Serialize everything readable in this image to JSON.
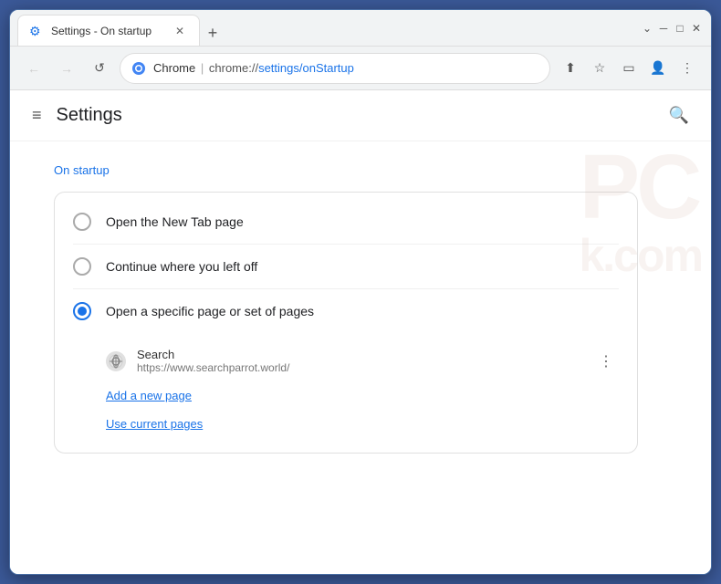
{
  "window": {
    "title": "Settings - On startup",
    "close_label": "✕",
    "minimize_label": "─",
    "maximize_label": "□",
    "dropdown_label": "⌄"
  },
  "tab": {
    "favicon": "⚙",
    "title": "Settings - On startup",
    "close": "✕"
  },
  "new_tab_button": "+",
  "address_bar": {
    "back": "←",
    "forward": "→",
    "refresh": "↺",
    "brand": "Chrome",
    "separator": "|",
    "url_display": "chrome://settings/onStartup",
    "url_prefix": "chrome://",
    "url_path": "settings/onStartup",
    "share_icon": "⬆",
    "bookmark_icon": "☆",
    "sidebar_icon": "▭",
    "profile_icon": "👤",
    "menu_icon": "⋮"
  },
  "page": {
    "menu_icon": "≡",
    "title": "Settings",
    "search_icon": "🔍"
  },
  "on_startup": {
    "section_label": "On startup",
    "options": [
      {
        "id": "new-tab",
        "label": "Open the New Tab page",
        "selected": false
      },
      {
        "id": "continue",
        "label": "Continue where you left off",
        "selected": false
      },
      {
        "id": "specific",
        "label": "Open a specific page or set of pages",
        "selected": true
      }
    ],
    "startup_site": {
      "name": "Search",
      "url": "https://www.searchparrot.world/",
      "more_icon": "⋮"
    },
    "add_new_page": "Add a new page",
    "use_current_pages": "Use current pages"
  },
  "watermark": {
    "line1": "PC",
    "line2": "k.com"
  }
}
